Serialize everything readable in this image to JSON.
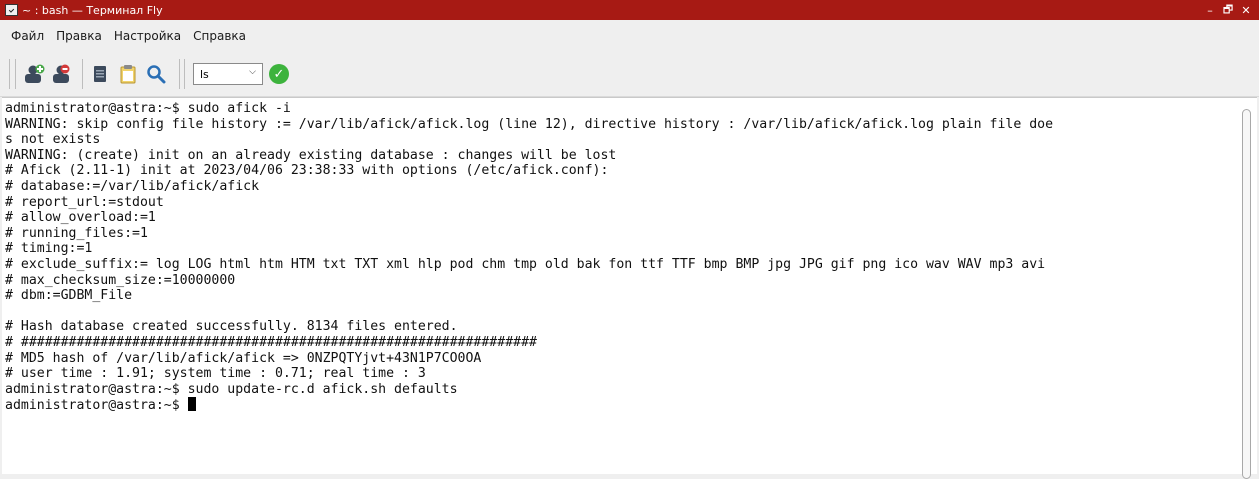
{
  "window": {
    "title": "~ : bash — Терминал Fly",
    "minimize": "–",
    "maximize": "🗗",
    "close": "✕"
  },
  "menu": [
    "Файл",
    "Правка",
    "Настройка",
    "Справка"
  ],
  "toolbar": {
    "icons": [
      "new-session-icon",
      "close-session-icon",
      "copy-icon",
      "paste-icon",
      "search-icon"
    ],
    "command_value": "ls",
    "run_icon": "checkmark-icon"
  },
  "terminal": {
    "lines": [
      "administrator@astra:~$ sudo afick -i",
      "WARNING: skip config file history := /var/lib/afick/afick.log (line 12), directive history : /var/lib/afick/afick.log plain file doe",
      "s not exists",
      "WARNING: (create) init on an already existing database : changes will be lost",
      "# Afick (2.11-1) init at 2023/04/06 23:38:33 with options (/etc/afick.conf):",
      "# database:=/var/lib/afick/afick",
      "# report_url:=stdout",
      "# allow_overload:=1",
      "# running_files:=1",
      "# timing:=1",
      "# exclude_suffix:= log LOG html htm HTM txt TXT xml hlp pod chm tmp old bak fon ttf TTF bmp BMP jpg JPG gif png ico wav WAV mp3 avi",
      "# max_checksum_size:=10000000",
      "# dbm:=GDBM_File",
      "",
      "# Hash database created successfully. 8134 files entered.",
      "# #################################################################",
      "# MD5 hash of /var/lib/afick/afick => 0NZPQTYjvt+43N1P7CO0OA",
      "# user time : 1.91; system time : 0.71; real time : 3",
      "administrator@astra:~$ sudo update-rc.d afick.sh defaults"
    ],
    "prompt": "administrator@astra:~$ "
  }
}
